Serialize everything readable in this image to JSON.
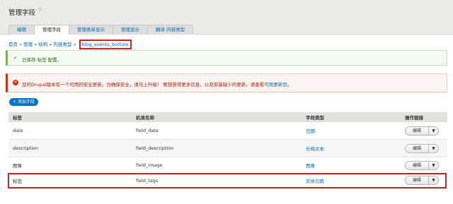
{
  "page": {
    "title": "管理字段",
    "star": "☆"
  },
  "tabs": [
    {
      "label": "编辑",
      "active": false
    },
    {
      "label": "管理字段",
      "active": true
    },
    {
      "label": "管理表单显示",
      "active": false
    },
    {
      "label": "管理显示",
      "active": false
    },
    {
      "label": "翻译 内容类型",
      "active": false
    }
  ],
  "breadcrumb": {
    "items": [
      "首页",
      "管理",
      "结构",
      "内容类型"
    ],
    "separator": "»",
    "current": "blog_events_bottom"
  },
  "status": {
    "icon": "✔",
    "text": "已保存 标签 配置。"
  },
  "error": {
    "icon": "✕",
    "text": "您的Drupal版本有一个可用的安全更新。为确保安全，请马上升级！ 要想获得更多信息，以及安装缺少的更新，请查看",
    "link": "可用更新页",
    "suffix": "。"
  },
  "add_button": "+ 添加字段",
  "table": {
    "headers": [
      "标签",
      "机读名称",
      "字段类型",
      "操作链接"
    ],
    "rows": [
      {
        "label": "date",
        "machine": "field_date",
        "type": "日期",
        "op": "编辑"
      },
      {
        "label": "description",
        "machine": "field_description",
        "type": "长纯文本",
        "op": "编辑"
      },
      {
        "label": "图像",
        "machine": "field_image",
        "type": "图像",
        "op": "编辑"
      },
      {
        "label": "标签",
        "machine": "field_tags",
        "type": "实体引用",
        "op": "编辑"
      }
    ]
  },
  "colors": {
    "accent": "#0074bd",
    "link": "#0066aa",
    "highlight": "#cc2222",
    "ok": "#77b259",
    "error": "#e62600"
  },
  "icons": {
    "star": "star-icon",
    "check": "check-icon",
    "error": "error-icon",
    "dropdown": "chevron-down-icon"
  }
}
